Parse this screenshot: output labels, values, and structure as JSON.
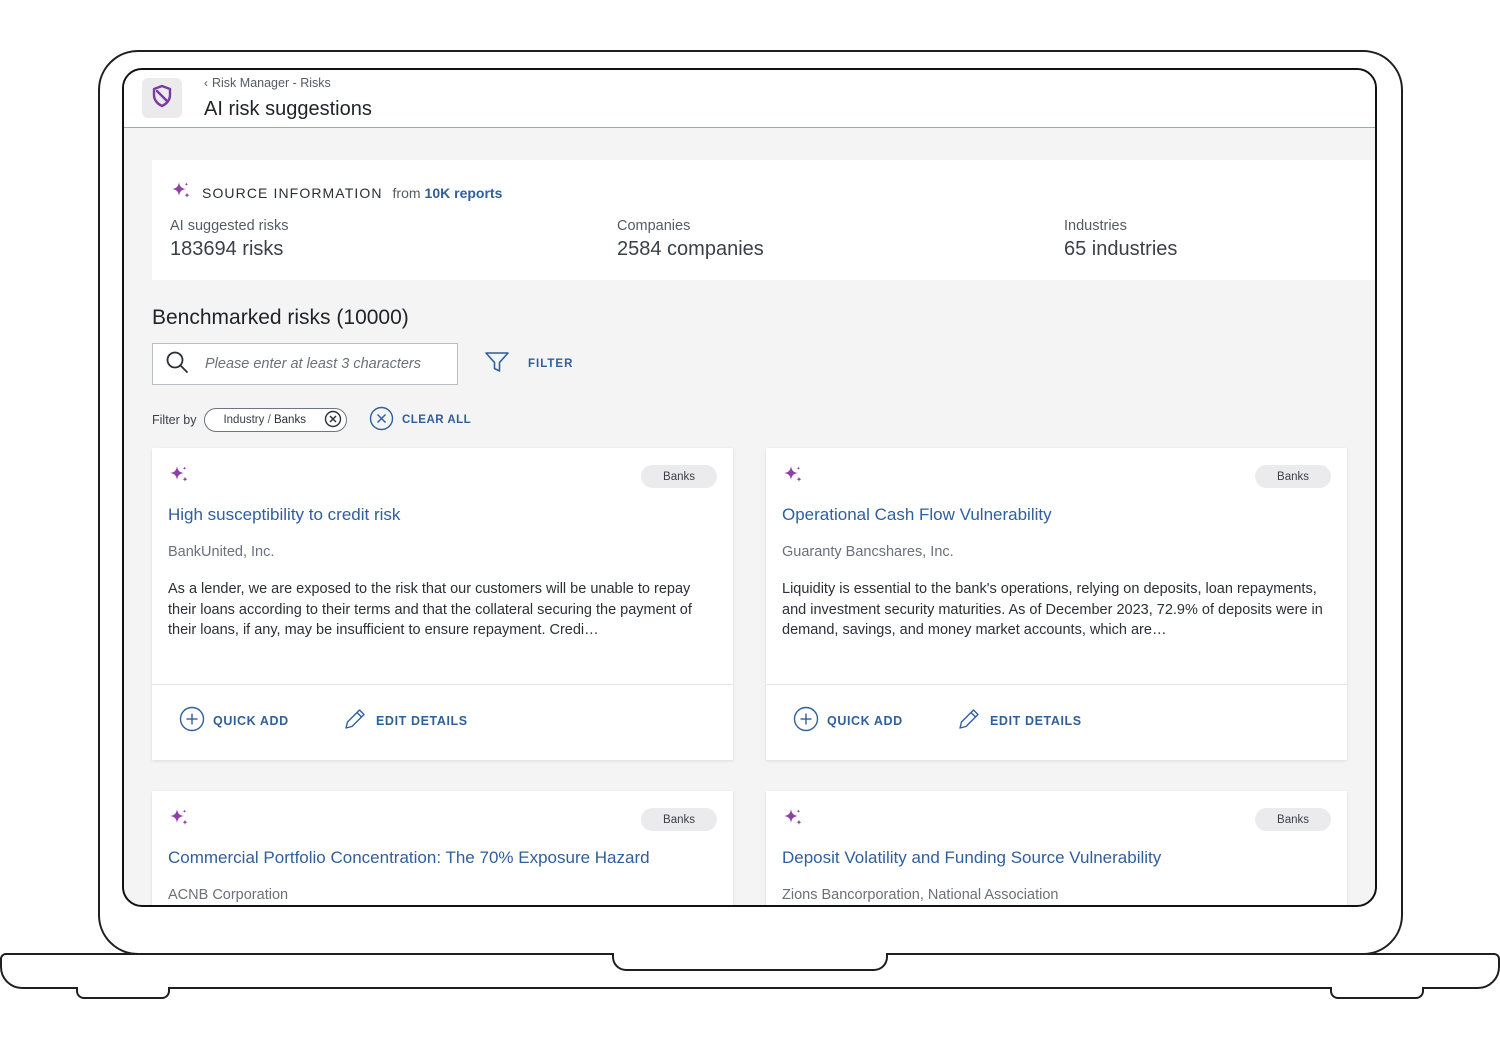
{
  "header": {
    "breadcrumb": "Risk Manager - Risks",
    "title": "AI risk suggestions"
  },
  "source": {
    "title": "SOURCE INFORMATION",
    "from": "from",
    "link": "10K reports",
    "stats": [
      {
        "label": "AI suggested risks",
        "value": "183694 risks"
      },
      {
        "label": "Companies",
        "value": "2584 companies"
      },
      {
        "label": "Industries",
        "value": "65 industries"
      }
    ]
  },
  "benchmarked": {
    "title": "Benchmarked risks (10000)",
    "search_placeholder": "Please enter at least 3 characters",
    "filter_label": "FILTER",
    "filter_by": "Filter by",
    "chip": {
      "key": "Industry",
      "sep": "/",
      "value": "Banks"
    },
    "clear_all": "CLEAR ALL"
  },
  "cards": [
    {
      "badge": "Banks",
      "title": "High susceptibility to credit risk",
      "company": "BankUnited, Inc.",
      "description": "As a lender, we are exposed to the risk that our customers will be unable to repay their loans according to their terms and that the collateral securing the payment of their loans, if any, may be insufficient to ensure repayment. Credi…",
      "quick_add": "QUICK ADD",
      "edit_details": "EDIT DETAILS"
    },
    {
      "badge": "Banks",
      "title": "Operational Cash Flow Vulnerability",
      "company": "Guaranty Bancshares, Inc.",
      "description": "Liquidity is essential to the bank's operations, relying on deposits, loan repayments, and investment security maturities. As of December 2023, 72.9% of deposits were in demand, savings, and money market accounts, which are…",
      "quick_add": "QUICK ADD",
      "edit_details": "EDIT DETAILS"
    },
    {
      "badge": "Banks",
      "title": "Commercial Portfolio Concentration: The 70% Exposure Hazard",
      "company": "ACNB Corporation"
    },
    {
      "badge": "Banks",
      "title": "Deposit Volatility and Funding Source Vulnerability",
      "company": "Zions Bancorporation, National Association"
    }
  ],
  "colors": {
    "accent": "#2f5f9c",
    "sparkle": "#8e3fa8",
    "logo": "#7b3aa0"
  },
  "icons": [
    "shield-icon",
    "chevron-left-icon",
    "sparkle-icon",
    "search-icon",
    "filter-icon",
    "close-circle-icon",
    "plus-circle-icon",
    "pencil-icon"
  ]
}
